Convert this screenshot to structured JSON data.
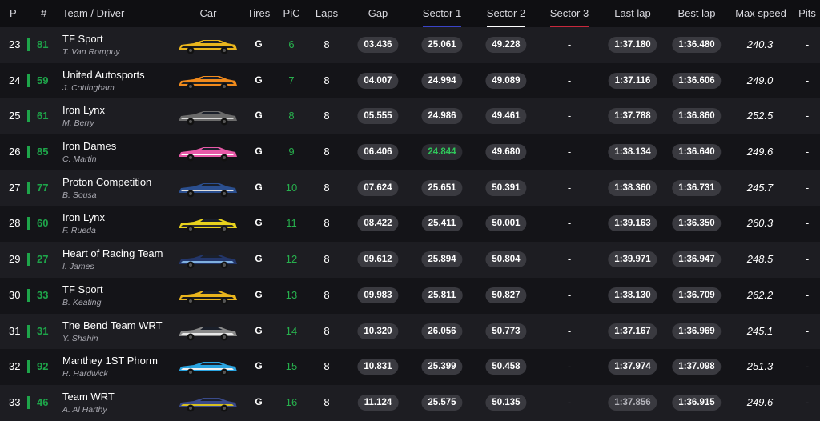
{
  "columns": {
    "p": "P",
    "num": "#",
    "team_driver": "Team / Driver",
    "car": "Car",
    "tires": "Tires",
    "pic": "PiC",
    "laps": "Laps",
    "gap": "Gap",
    "sector1": "Sector 1",
    "sector2": "Sector 2",
    "sector3": "Sector 3",
    "last_lap": "Last lap",
    "best_lap": "Best lap",
    "max_speed": "Max speed",
    "pits": "Pits"
  },
  "colors": {
    "accent_green": "#1ea54a",
    "sector1_line": "#3a44c8",
    "sector2_line": "#ffffff",
    "sector3_line": "#c8283c"
  },
  "rows": [
    {
      "p": "23",
      "num": "81",
      "team": "TF Sport",
      "driver": "T. Van Rompuy",
      "car_colors": [
        "#e9b51d",
        "#1a1a1a"
      ],
      "tires": "G",
      "pic": "6",
      "laps": "8",
      "gap": "03.436",
      "s1": "25.061",
      "s2": "49.228",
      "s3": "-",
      "last": "1:37.180",
      "best": "1:36.480",
      "speed": "240.3",
      "pits": "-"
    },
    {
      "p": "24",
      "num": "59",
      "team": "United Autosports",
      "driver": "J. Cottingham",
      "car_colors": [
        "#f08a1c",
        "#222222"
      ],
      "tires": "G",
      "pic": "7",
      "laps": "8",
      "gap": "04.007",
      "s1": "24.994",
      "s2": "49.089",
      "s3": "-",
      "last": "1:37.116",
      "best": "1:36.606",
      "speed": "249.0",
      "pits": "-"
    },
    {
      "p": "25",
      "num": "61",
      "team": "Iron Lynx",
      "driver": "M. Berry",
      "car_colors": [
        "#6a6a6a",
        "#d8d8d8"
      ],
      "tires": "G",
      "pic": "8",
      "laps": "8",
      "gap": "05.555",
      "s1": "24.986",
      "s2": "49.461",
      "s3": "-",
      "last": "1:37.788",
      "best": "1:36.860",
      "speed": "252.5",
      "pits": "-"
    },
    {
      "p": "26",
      "num": "85",
      "team": "Iron Dames",
      "driver": "C. Martin",
      "car_colors": [
        "#e85aa8",
        "#ffffff"
      ],
      "tires": "G",
      "pic": "9",
      "laps": "8",
      "gap": "06.406",
      "s1": "24.844",
      "s1_best": true,
      "s2": "49.680",
      "s3": "-",
      "last": "1:38.134",
      "best": "1:36.640",
      "speed": "249.6",
      "pits": "-"
    },
    {
      "p": "27",
      "num": "77",
      "team": "Proton Competition",
      "driver": "B. Sousa",
      "car_colors": [
        "#2b4f8f",
        "#e0e0e0"
      ],
      "tires": "G",
      "pic": "10",
      "laps": "8",
      "gap": "07.624",
      "s1": "25.651",
      "s2": "50.391",
      "s3": "-",
      "last": "1:38.360",
      "best": "1:36.731",
      "speed": "245.7",
      "pits": "-"
    },
    {
      "p": "28",
      "num": "60",
      "team": "Iron Lynx",
      "driver": "F. Rueda",
      "car_colors": [
        "#e8d21d",
        "#2a2a2a"
      ],
      "tires": "G",
      "pic": "11",
      "laps": "8",
      "gap": "08.422",
      "s1": "25.411",
      "s2": "50.001",
      "s3": "-",
      "last": "1:39.163",
      "best": "1:36.350",
      "speed": "260.3",
      "pits": "-"
    },
    {
      "p": "29",
      "num": "27",
      "team": "Heart of Racing Team",
      "driver": "I. James",
      "car_colors": [
        "#23366a",
        "#7fb0e0"
      ],
      "tires": "G",
      "pic": "12",
      "laps": "8",
      "gap": "09.612",
      "s1": "25.894",
      "s2": "50.804",
      "s3": "-",
      "last": "1:39.971",
      "best": "1:36.947",
      "speed": "248.5",
      "pits": "-"
    },
    {
      "p": "30",
      "num": "33",
      "team": "TF Sport",
      "driver": "B. Keating",
      "car_colors": [
        "#e9b51d",
        "#1a1a1a"
      ],
      "tires": "G",
      "pic": "13",
      "laps": "8",
      "gap": "09.983",
      "s1": "25.811",
      "s2": "50.827",
      "s3": "-",
      "last": "1:38.130",
      "best": "1:36.709",
      "speed": "262.2",
      "pits": "-"
    },
    {
      "p": "31",
      "num": "31",
      "team": "The Bend Team WRT",
      "driver": "Y. Shahin",
      "car_colors": [
        "#8a8a8a",
        "#e8e8e8"
      ],
      "tires": "G",
      "pic": "14",
      "laps": "8",
      "gap": "10.320",
      "s1": "26.056",
      "s2": "50.773",
      "s3": "-",
      "last": "1:37.167",
      "best": "1:36.969",
      "speed": "245.1",
      "pits": "-"
    },
    {
      "p": "32",
      "num": "92",
      "team": "Manthey 1ST Phorm",
      "driver": "R. Hardwick",
      "car_colors": [
        "#2aa4e0",
        "#f0f0f0"
      ],
      "tires": "G",
      "pic": "15",
      "laps": "8",
      "gap": "10.831",
      "s1": "25.399",
      "s2": "50.458",
      "s3": "-",
      "last": "1:37.974",
      "best": "1:37.098",
      "speed": "251.3",
      "pits": "-"
    },
    {
      "p": "33",
      "num": "46",
      "team": "Team WRT",
      "driver": "A. Al Harthy",
      "car_colors": [
        "#3a4a8a",
        "#d8c020"
      ],
      "tires": "G",
      "pic": "16",
      "laps": "8",
      "gap": "11.124",
      "s1": "25.575",
      "s2": "50.135",
      "s3": "-",
      "last": "1:37.856",
      "last_dim": true,
      "best": "1:36.915",
      "speed": "249.6",
      "pits": "-"
    }
  ]
}
